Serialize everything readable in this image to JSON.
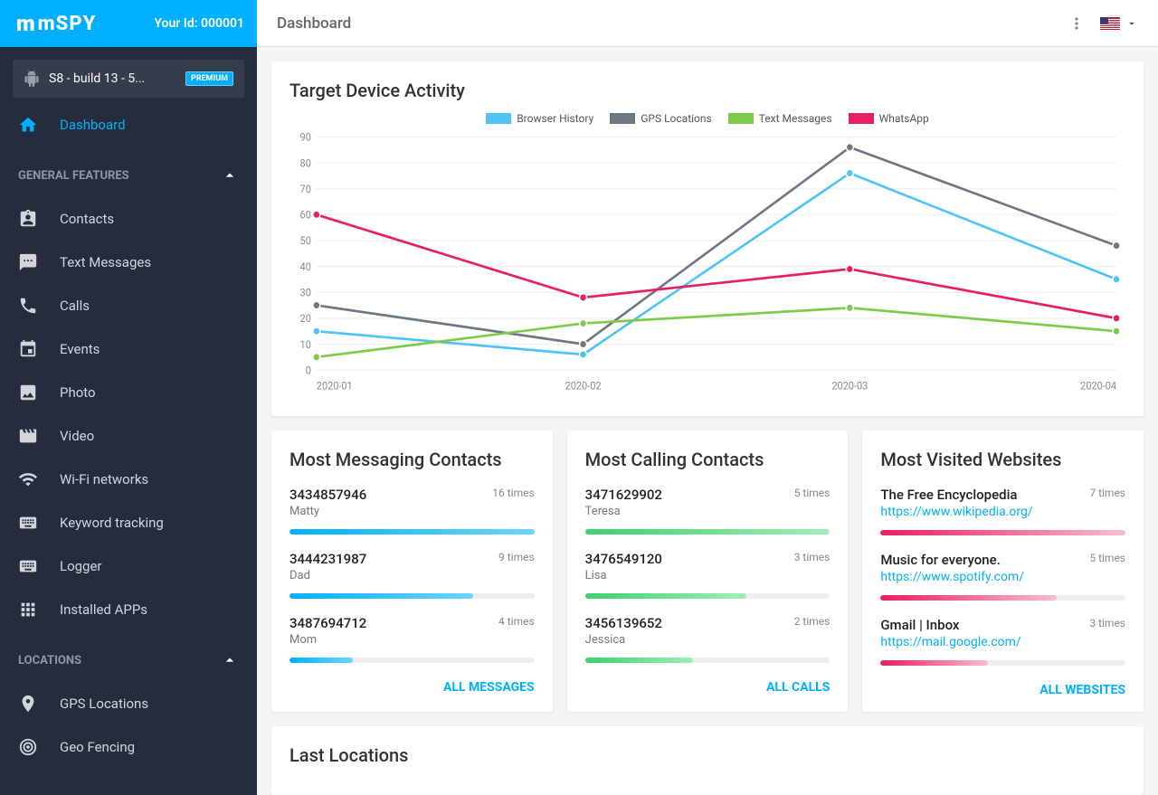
{
  "brand": "mSPY",
  "user_id_label": "Your Id: 000001",
  "device": {
    "name": "S8 - build 13 - 5...",
    "badge": "PREMIUM"
  },
  "sidebar": {
    "active": "Dashboard",
    "sections": [
      {
        "label": "GENERAL FEATURES",
        "items": [
          {
            "label": "Contacts",
            "icon": "contacts"
          },
          {
            "label": "Text Messages",
            "icon": "sms"
          },
          {
            "label": "Calls",
            "icon": "call"
          },
          {
            "label": "Events",
            "icon": "event"
          },
          {
            "label": "Photo",
            "icon": "photo"
          },
          {
            "label": "Video",
            "icon": "video"
          },
          {
            "label": "Wi-Fi networks",
            "icon": "wifi"
          },
          {
            "label": "Keyword tracking",
            "icon": "keyboard"
          },
          {
            "label": "Logger",
            "icon": "keyboard"
          },
          {
            "label": "Installed APPs",
            "icon": "apps"
          }
        ]
      },
      {
        "label": "LOCATIONS",
        "items": [
          {
            "label": "GPS Locations",
            "icon": "pin"
          },
          {
            "label": "Geo Fencing",
            "icon": "target"
          }
        ]
      }
    ]
  },
  "page_title": "Dashboard",
  "activity_title": "Target Device Activity",
  "chart_data": {
    "type": "line",
    "title": "Target Device Activity",
    "xlabel": "",
    "ylabel": "",
    "ylim": [
      0,
      90
    ],
    "categories": [
      "2020-01",
      "2020-02",
      "2020-03",
      "2020-04"
    ],
    "series": [
      {
        "name": "Browser History",
        "color": "#4FC3F7",
        "values": [
          15,
          6,
          76,
          35
        ]
      },
      {
        "name": "GPS Locations",
        "color": "#6E7783",
        "values": [
          25,
          10,
          86,
          48
        ]
      },
      {
        "name": "Text Messages",
        "color": "#7CCB4A",
        "values": [
          5,
          18,
          24,
          15
        ]
      },
      {
        "name": "WhatsApp",
        "color": "#E91E63",
        "values": [
          60,
          28,
          39,
          20
        ]
      }
    ]
  },
  "most_msg": {
    "title": "Most Messaging Contacts",
    "items": [
      {
        "num": "3434857946",
        "sub": "Matty",
        "count": "16 times",
        "pct": 100
      },
      {
        "num": "3444231987",
        "sub": "Dad",
        "count": "9 times",
        "pct": 75
      },
      {
        "num": "3487694712",
        "sub": "Mom",
        "count": "4 times",
        "pct": 26
      }
    ],
    "grad": "grad-blue",
    "footer": "ALL MESSAGES"
  },
  "most_call": {
    "title": "Most Calling Contacts",
    "items": [
      {
        "num": "3471629902",
        "sub": "Teresa",
        "count": "5 times",
        "pct": 100
      },
      {
        "num": "3476549120",
        "sub": "Lisa",
        "count": "3 times",
        "pct": 66
      },
      {
        "num": "3456139652",
        "sub": "Jessica",
        "count": "2 times",
        "pct": 44
      }
    ],
    "grad": "grad-green",
    "footer": "ALL CALLS"
  },
  "most_web": {
    "title": "Most Visited Websites",
    "items": [
      {
        "num": "The Free Encyclopedia",
        "link": "https://www.wikipedia.org/",
        "count": "7 times",
        "pct": 100
      },
      {
        "num": "Music for everyone.",
        "link": "https://www.spotify.com/",
        "count": "5 times",
        "pct": 72
      },
      {
        "num": "Gmail | Inbox",
        "link": "https://mail.google.com/",
        "count": "3 times",
        "pct": 44
      }
    ],
    "grad": "grad-pink",
    "footer": "ALL WEBSITES"
  },
  "last_locations_title": "Last Locations"
}
